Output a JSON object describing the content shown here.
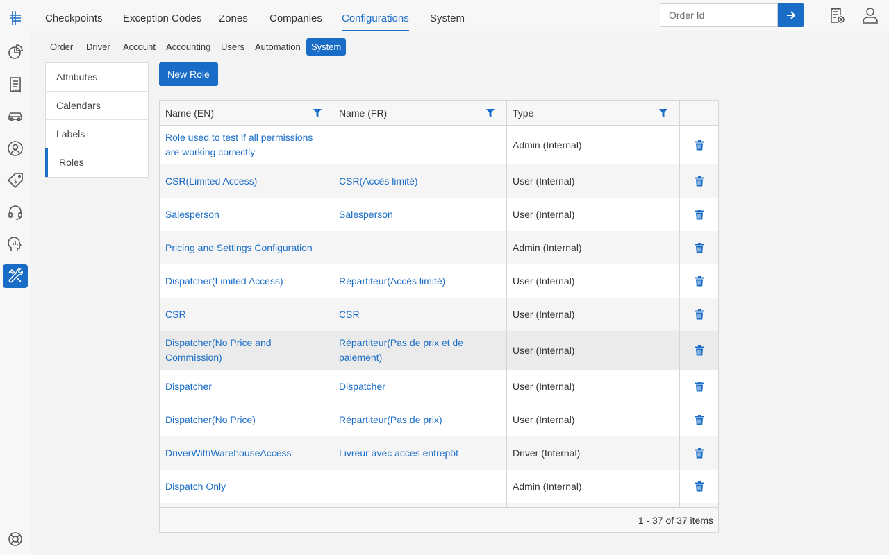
{
  "colors": {
    "accent": "#1a6dc7",
    "rail_bg": "#f7f7f7",
    "row_alt": "#f5f5f5"
  },
  "rail": {
    "items": [
      {
        "icon": "logo-icon",
        "active": false
      },
      {
        "icon": "dashboard-pie-icon",
        "active": false
      },
      {
        "icon": "receipt-icon",
        "active": false
      },
      {
        "icon": "car-icon",
        "active": false
      },
      {
        "icon": "user-circle-icon",
        "active": false
      },
      {
        "icon": "price-tag-icon",
        "active": false
      },
      {
        "icon": "headset-icon",
        "active": false
      },
      {
        "icon": "analytics-head-icon",
        "active": false
      },
      {
        "icon": "tools-icon",
        "active": true
      },
      {
        "icon": "lifebuoy-icon",
        "active": false
      }
    ]
  },
  "topnav": {
    "tabs": [
      {
        "label": "Checkpoints",
        "active": false
      },
      {
        "label": "Exception Codes",
        "active": false
      },
      {
        "label": "Zones",
        "active": false
      },
      {
        "label": "Companies",
        "active": false
      },
      {
        "label": "Configurations",
        "active": true
      },
      {
        "label": "System",
        "active": false
      }
    ],
    "search": {
      "placeholder": "Order Id",
      "value": ""
    },
    "icons": [
      "new-order-icon",
      "user-profile-icon"
    ]
  },
  "subnav": {
    "tabs": [
      {
        "label": "Order",
        "active": false
      },
      {
        "label": "Driver",
        "active": false
      },
      {
        "label": "Account",
        "active": false
      },
      {
        "label": "Accounting",
        "active": false
      },
      {
        "label": "Users",
        "active": false
      },
      {
        "label": "Automation",
        "active": false
      },
      {
        "label": "System",
        "active": true
      }
    ]
  },
  "side": {
    "items": [
      {
        "label": "Attributes",
        "active": false
      },
      {
        "label": "Calendars",
        "active": false
      },
      {
        "label": "Labels",
        "active": false
      },
      {
        "label": "Roles",
        "active": true
      }
    ]
  },
  "actions": {
    "new_role": "New Role"
  },
  "grid": {
    "columns": [
      "Name (EN)",
      "Name (FR)",
      "Type",
      ""
    ],
    "rows": [
      {
        "name_en": "Role used to test if all permissions are working correctly",
        "name_fr": "",
        "type": "Admin (Internal)"
      },
      {
        "name_en": "CSR(Limited Access)",
        "name_fr": "CSR(Accès limité)",
        "type": "User (Internal)"
      },
      {
        "name_en": "Salesperson",
        "name_fr": "Salesperson",
        "type": "User (Internal)"
      },
      {
        "name_en": "Pricing and Settings Configuration",
        "name_fr": "",
        "type": "Admin (Internal)"
      },
      {
        "name_en": "Dispatcher(Limited Access)",
        "name_fr": "Répartiteur(Accès limité)",
        "type": "User (Internal)"
      },
      {
        "name_en": "CSR",
        "name_fr": "CSR",
        "type": "User (Internal)"
      },
      {
        "name_en": "Dispatcher(No Price and Commission)",
        "name_fr": "Répartiteur(Pas de prix et de paiement)",
        "type": "User (Internal)"
      },
      {
        "name_en": "Dispatcher",
        "name_fr": "Dispatcher",
        "type": "User (Internal)"
      },
      {
        "name_en": "Dispatcher(No Price)",
        "name_fr": "Répartiteur(Pas de prix)",
        "type": "User (Internal)"
      },
      {
        "name_en": "DriverWithWarehouseAccess",
        "name_fr": "Livreur avec accès entrepôt",
        "type": "Driver (Internal)"
      },
      {
        "name_en": "Dispatch Only",
        "name_fr": "",
        "type": "Admin (Internal)"
      },
      {
        "name_en": "",
        "name_fr": "",
        "type": ""
      }
    ],
    "pager": "1 - 37 of 37 items"
  }
}
